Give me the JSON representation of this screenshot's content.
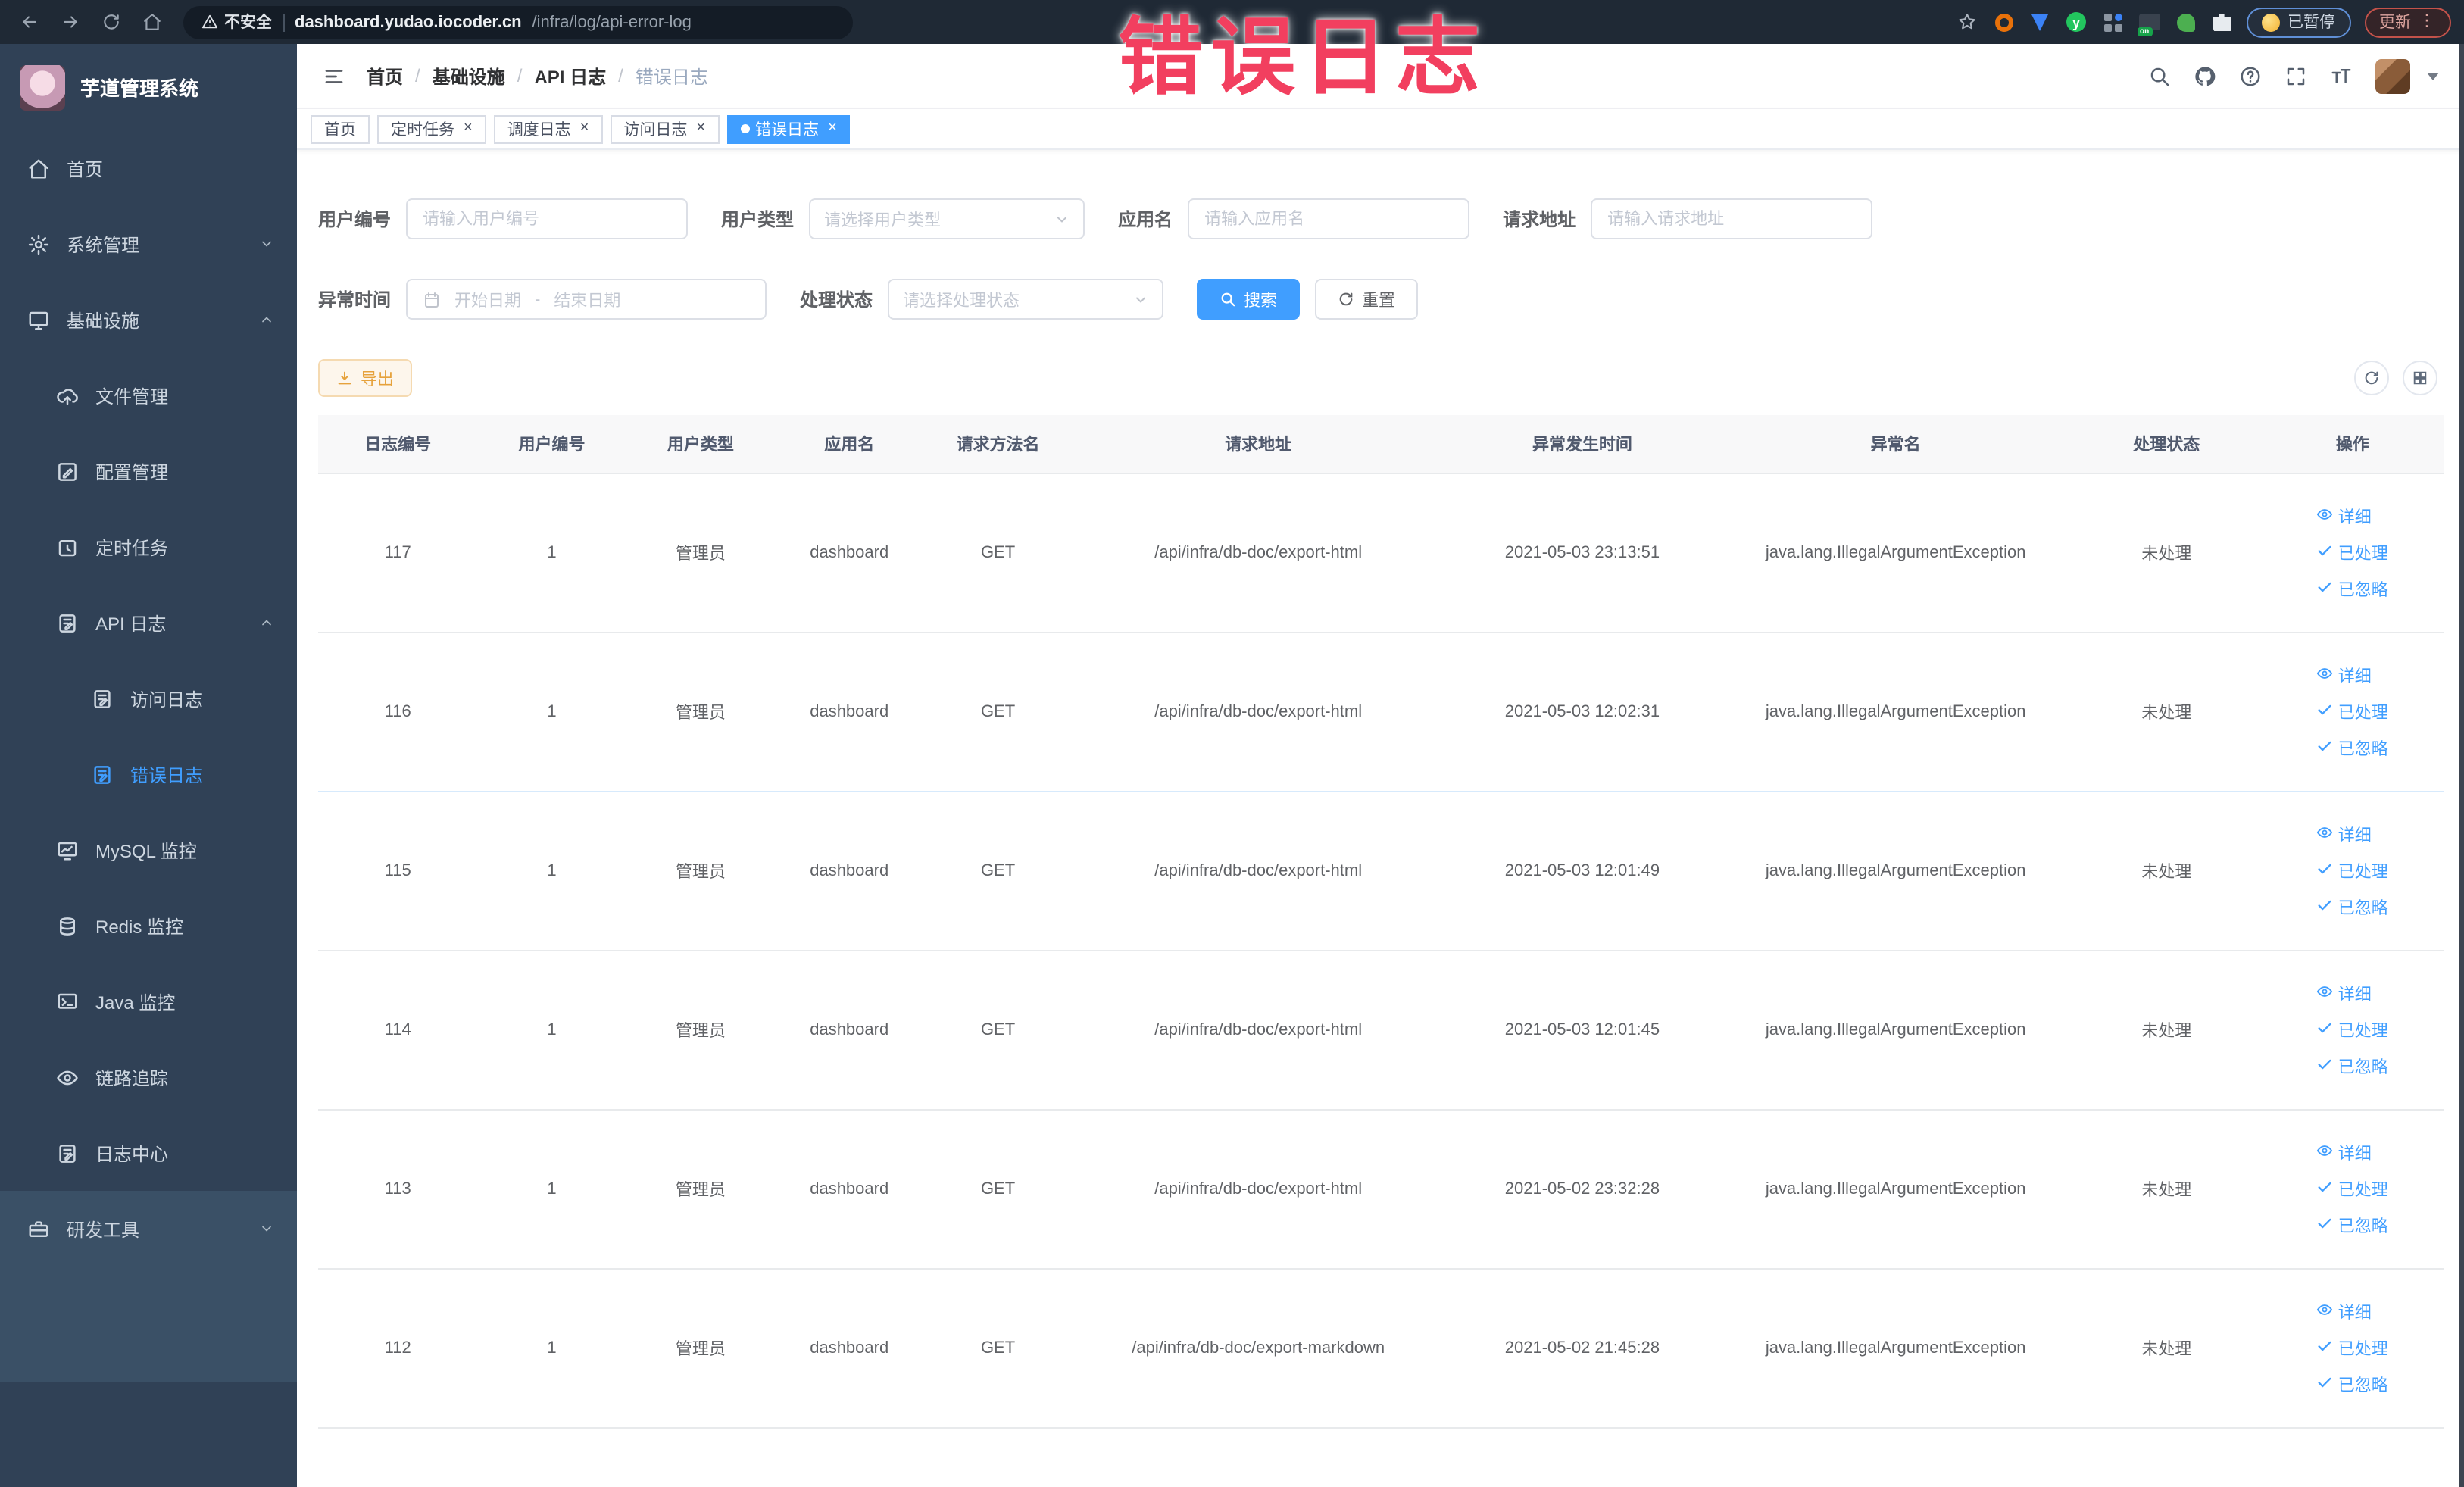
{
  "browser": {
    "security_label": "不安全",
    "url_domain": "dashboard.yudao.iocoder.cn",
    "url_path": "/infra/log/api-error-log",
    "ext_on_badge": "on",
    "ext_y_label": "y",
    "paused_badge": "已暂停",
    "update_badge": "更新"
  },
  "watermark_text": "错误日志",
  "sidebar": {
    "logo_title": "芋道管理系统",
    "items": [
      {
        "label": "首页",
        "icon": "home-icon",
        "level": 1
      },
      {
        "label": "系统管理",
        "icon": "gear-icon",
        "level": 1,
        "arrow": "down"
      },
      {
        "label": "基础设施",
        "icon": "monitor-icon",
        "level": 1,
        "arrow": "up"
      },
      {
        "label": "文件管理",
        "icon": "cloud-upload-icon",
        "level": 2
      },
      {
        "label": "配置管理",
        "icon": "edit-square-icon",
        "level": 2
      },
      {
        "label": "定时任务",
        "icon": "timer-icon",
        "level": 2
      },
      {
        "label": "API 日志",
        "icon": "log-edit-icon",
        "level": 2,
        "arrow": "up"
      },
      {
        "label": "访问日志",
        "icon": "log-edit-icon",
        "level": 3
      },
      {
        "label": "错误日志",
        "icon": "log-edit-icon",
        "level": 3,
        "active": true
      },
      {
        "label": "MySQL 监控",
        "icon": "chart-monitor-icon",
        "level": 2
      },
      {
        "label": "Redis 监控",
        "icon": "database-icon",
        "level": 2
      },
      {
        "label": "Java 监控",
        "icon": "terminal-icon",
        "level": 2
      },
      {
        "label": "链路追踪",
        "icon": "eye-icon",
        "level": 2
      },
      {
        "label": "日志中心",
        "icon": "log-edit-icon",
        "level": 2
      },
      {
        "label": "研发工具",
        "icon": "toolbox-icon",
        "level": 1,
        "arrow": "down",
        "section": "bottom"
      }
    ]
  },
  "header": {
    "breadcrumb": [
      "首页",
      "基础设施",
      "API 日志",
      "错误日志"
    ],
    "breadcrumb_separator": "/"
  },
  "tabs": [
    {
      "label": "首页",
      "closable": false,
      "active": false
    },
    {
      "label": "定时任务",
      "closable": true,
      "active": false
    },
    {
      "label": "调度日志",
      "closable": true,
      "active": false
    },
    {
      "label": "访问日志",
      "closable": true,
      "active": false
    },
    {
      "label": "错误日志",
      "closable": true,
      "active": true
    }
  ],
  "close_glyph": "×",
  "filters": {
    "row1": [
      {
        "label": "用户编号",
        "type": "input",
        "placeholder": "请输入用户编号"
      },
      {
        "label": "用户类型",
        "type": "select",
        "placeholder": "请选择用户类型"
      },
      {
        "label": "应用名",
        "type": "input",
        "placeholder": "请输入应用名"
      },
      {
        "label": "请求地址",
        "type": "input",
        "placeholder": "请输入请求地址"
      }
    ],
    "row2": {
      "time_label": "异常时间",
      "start_placeholder": "开始日期",
      "range_separator": "-",
      "end_placeholder": "结束日期",
      "status_label": "处理状态",
      "status_placeholder": "请选择处理状态",
      "search_label": "搜索",
      "reset_label": "重置"
    }
  },
  "toolbar": {
    "export_label": "导出"
  },
  "table": {
    "columns": [
      "日志编号",
      "用户编号",
      "用户类型",
      "应用名",
      "请求方法名",
      "请求地址",
      "异常发生时间",
      "异常名",
      "处理状态",
      "操作"
    ],
    "row_actions": [
      {
        "label": "详细",
        "icon": "eye-icon"
      },
      {
        "label": "已处理",
        "icon": "check-icon"
      },
      {
        "label": "已忽略",
        "icon": "check-icon"
      }
    ],
    "rows": [
      {
        "id": "117",
        "user_id": "1",
        "user_type": "管理员",
        "app": "dashboard",
        "method": "GET",
        "url": "/api/infra/db-doc/export-html",
        "time": "2021-05-03 23:13:51",
        "exception": "java.lang.IllegalArgumentException",
        "status": "未处理"
      },
      {
        "id": "116",
        "user_id": "1",
        "user_type": "管理员",
        "app": "dashboard",
        "method": "GET",
        "url": "/api/infra/db-doc/export-html",
        "time": "2021-05-03 12:02:31",
        "exception": "java.lang.IllegalArgumentException",
        "status": "未处理"
      },
      {
        "id": "115",
        "user_id": "1",
        "user_type": "管理员",
        "app": "dashboard",
        "method": "GET",
        "url": "/api/infra/db-doc/export-html",
        "time": "2021-05-03 12:01:49",
        "exception": "java.lang.IllegalArgumentException",
        "status": "未处理"
      },
      {
        "id": "114",
        "user_id": "1",
        "user_type": "管理员",
        "app": "dashboard",
        "method": "GET",
        "url": "/api/infra/db-doc/export-html",
        "time": "2021-05-03 12:01:45",
        "exception": "java.lang.IllegalArgumentException",
        "status": "未处理"
      },
      {
        "id": "113",
        "user_id": "1",
        "user_type": "管理员",
        "app": "dashboard",
        "method": "GET",
        "url": "/api/infra/db-doc/export-html",
        "time": "2021-05-02 23:32:28",
        "exception": "java.lang.IllegalArgumentException",
        "status": "未处理"
      },
      {
        "id": "112",
        "user_id": "1",
        "user_type": "管理员",
        "app": "dashboard",
        "method": "GET",
        "url": "/api/infra/db-doc/export-markdown",
        "time": "2021-05-02 21:45:28",
        "exception": "java.lang.IllegalArgumentException",
        "status": "未处理"
      }
    ]
  },
  "colors": {
    "primary": "#409eff",
    "watermark_red": "#f23f5f",
    "sidebar_bg": "#304156",
    "sidebar_bottom_bg": "#3a5066",
    "warning_text": "#e6a23c",
    "warning_bg": "#fdf6ec",
    "browser_bar": "#1f2935"
  }
}
